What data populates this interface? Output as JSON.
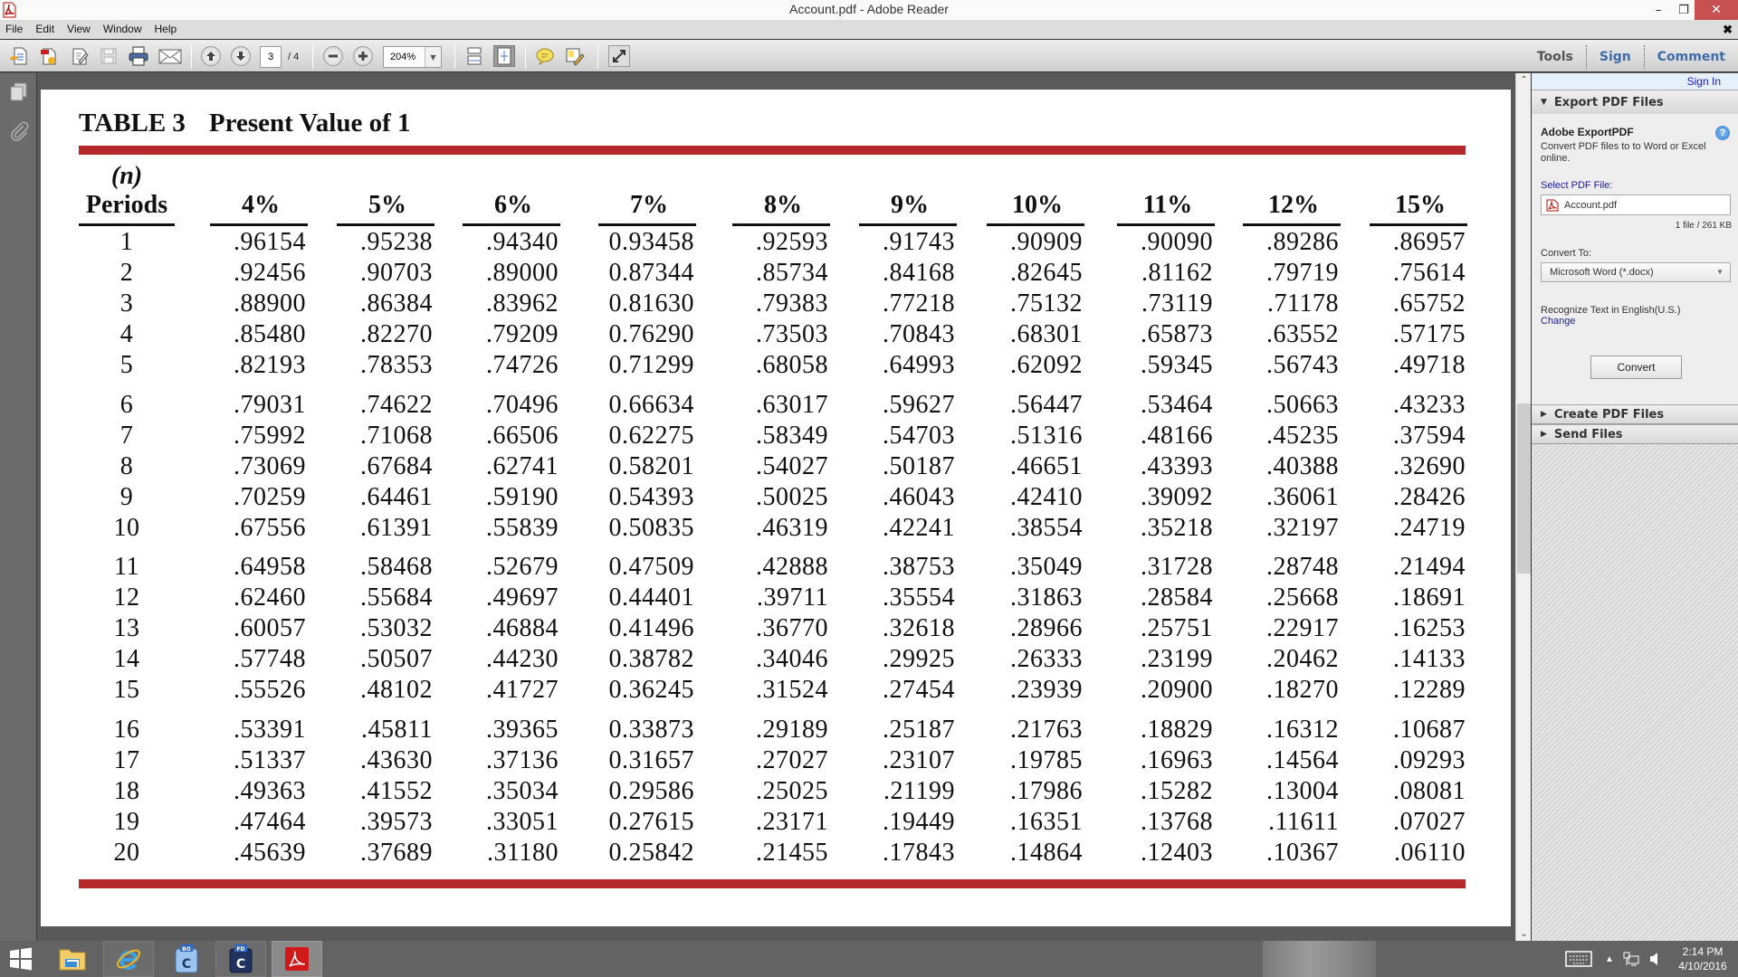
{
  "window": {
    "title": "Account.pdf - Adobe Reader",
    "controls": {
      "minimize": "–",
      "maximize": "❐",
      "close": "✕"
    }
  },
  "menubar": {
    "items": [
      "File",
      "Edit",
      "View",
      "Window",
      "Help"
    ],
    "close_doc": "✖"
  },
  "toolbar": {
    "current_page": "3",
    "total_pages": "/ 4",
    "zoom_level": "204%",
    "right_tabs": {
      "tools": "Tools",
      "sign": "Sign",
      "comment": "Comment"
    }
  },
  "right_pane": {
    "sign_in": "Sign In",
    "export_section": "Export PDF Files",
    "export_heading": "Adobe ExportPDF",
    "export_description": "Convert PDF files to to Word or Excel online.",
    "select_label": "Select PDF File:",
    "selected_file": "Account.pdf",
    "file_count": "1 file / 261 KB",
    "convert_to_label": "Convert To:",
    "convert_to_value": "Microsoft Word (*.docx)",
    "ocr_text": "Recognize Text in English(U.S.)",
    "change_link": "Change",
    "convert_button": "Convert",
    "create_section": "Create PDF Files",
    "send_section": "Send Files"
  },
  "document": {
    "table_label": "TABLE 3",
    "table_title": "Present Value of 1",
    "header_n": "(n)",
    "header_periods": "Periods",
    "rates": [
      "4%",
      "5%",
      "6%",
      "7%",
      "8%",
      "9%",
      "10%",
      "11%",
      "12%",
      "15%"
    ],
    "rows": [
      [
        "1",
        ".96154",
        ".95238",
        ".94340",
        "0.93458",
        ".92593",
        ".91743",
        ".90909",
        ".90090",
        ".89286",
        ".86957"
      ],
      [
        "2",
        ".92456",
        ".90703",
        ".89000",
        "0.87344",
        ".85734",
        ".84168",
        ".82645",
        ".81162",
        ".79719",
        ".75614"
      ],
      [
        "3",
        ".88900",
        ".86384",
        ".83962",
        "0.81630",
        ".79383",
        ".77218",
        ".75132",
        ".73119",
        ".71178",
        ".65752"
      ],
      [
        "4",
        ".85480",
        ".82270",
        ".79209",
        "0.76290",
        ".73503",
        ".70843",
        ".68301",
        ".65873",
        ".63552",
        ".57175"
      ],
      [
        "5",
        ".82193",
        ".78353",
        ".74726",
        "0.71299",
        ".68058",
        ".64993",
        ".62092",
        ".59345",
        ".56743",
        ".49718"
      ],
      [
        "6",
        ".79031",
        ".74622",
        ".70496",
        "0.66634",
        ".63017",
        ".59627",
        ".56447",
        ".53464",
        ".50663",
        ".43233"
      ],
      [
        "7",
        ".75992",
        ".71068",
        ".66506",
        "0.62275",
        ".58349",
        ".54703",
        ".51316",
        ".48166",
        ".45235",
        ".37594"
      ],
      [
        "8",
        ".73069",
        ".67684",
        ".62741",
        "0.58201",
        ".54027",
        ".50187",
        ".46651",
        ".43393",
        ".40388",
        ".32690"
      ],
      [
        "9",
        ".70259",
        ".64461",
        ".59190",
        "0.54393",
        ".50025",
        ".46043",
        ".42410",
        ".39092",
        ".36061",
        ".28426"
      ],
      [
        "10",
        ".67556",
        ".61391",
        ".55839",
        "0.50835",
        ".46319",
        ".42241",
        ".38554",
        ".35218",
        ".32197",
        ".24719"
      ],
      [
        "11",
        ".64958",
        ".58468",
        ".52679",
        "0.47509",
        ".42888",
        ".38753",
        ".35049",
        ".31728",
        ".28748",
        ".21494"
      ],
      [
        "12",
        ".62460",
        ".55684",
        ".49697",
        "0.44401",
        ".39711",
        ".35554",
        ".31863",
        ".28584",
        ".25668",
        ".18691"
      ],
      [
        "13",
        ".60057",
        ".53032",
        ".46884",
        "0.41496",
        ".36770",
        ".32618",
        ".28966",
        ".25751",
        ".22917",
        ".16253"
      ],
      [
        "14",
        ".57748",
        ".50507",
        ".44230",
        "0.38782",
        ".34046",
        ".29925",
        ".26333",
        ".23199",
        ".20462",
        ".14133"
      ],
      [
        "15",
        ".55526",
        ".48102",
        ".41727",
        "0.36245",
        ".31524",
        ".27454",
        ".23939",
        ".20900",
        ".18270",
        ".12289"
      ],
      [
        "16",
        ".53391",
        ".45811",
        ".39365",
        "0.33873",
        ".29189",
        ".25187",
        ".21763",
        ".18829",
        ".16312",
        ".10687"
      ],
      [
        "17",
        ".51337",
        ".43630",
        ".37136",
        "0.31657",
        ".27027",
        ".23107",
        ".19785",
        ".16963",
        ".14564",
        ".09293"
      ],
      [
        "18",
        ".49363",
        ".41552",
        ".35034",
        "0.29586",
        ".25025",
        ".21199",
        ".17986",
        ".15282",
        ".13004",
        ".08081"
      ],
      [
        "19",
        ".47464",
        ".39573",
        ".33051",
        "0.27615",
        ".23171",
        ".19449",
        ".16351",
        ".13768",
        ".11611",
        ".07027"
      ],
      [
        "20",
        ".45639",
        ".37689",
        ".31180",
        "0.25842",
        ".21455",
        ".17843",
        ".14864",
        ".12403",
        ".10367",
        ".06110"
      ]
    ],
    "accent_color": "#b5282b"
  },
  "taskbar": {
    "apps": [
      "start",
      "file-explorer",
      "internet-explorer",
      "bo-app",
      "fd-app",
      "adobe-reader"
    ],
    "bo_label": "BO",
    "fd_label": "FD",
    "c_glyph": "C",
    "time": "2:14 PM",
    "date": "4/10/2016"
  }
}
